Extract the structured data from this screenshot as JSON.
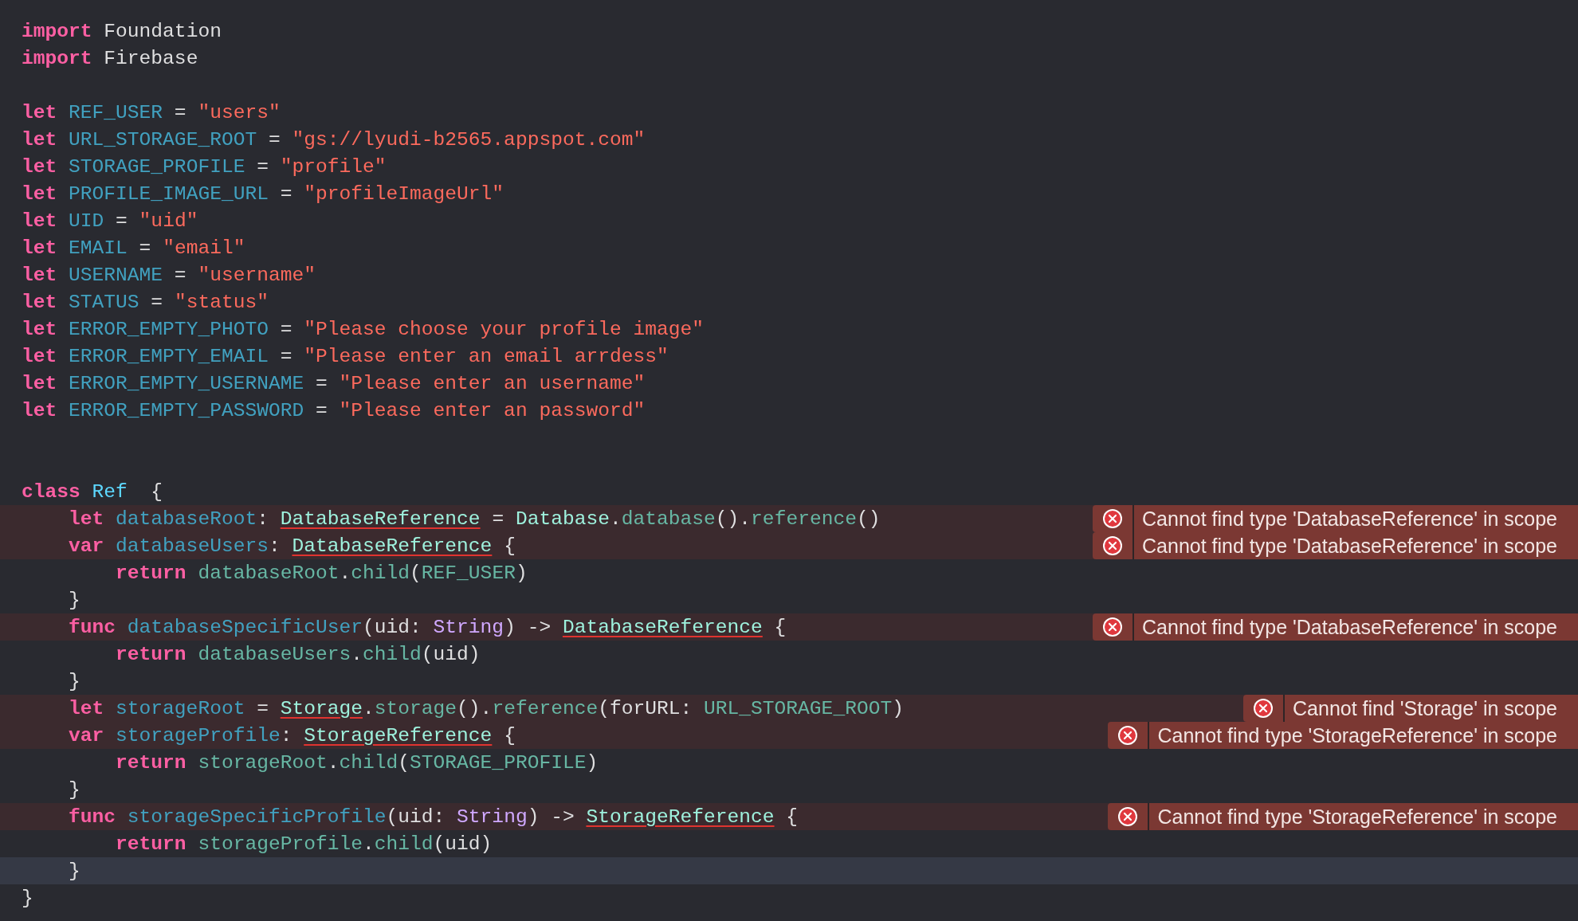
{
  "editor": {
    "lines": [
      {
        "current": false,
        "tokens": [
          {
            "kind": "keyword",
            "text": "import"
          },
          {
            "kind": "plain",
            "text": " Foundation"
          }
        ]
      },
      {
        "current": false,
        "tokens": [
          {
            "kind": "keyword",
            "text": "import"
          },
          {
            "kind": "plain",
            "text": " Firebase"
          }
        ]
      },
      {
        "current": false
      },
      {
        "current": false,
        "tokens": [
          {
            "kind": "keyword",
            "text": "let"
          },
          {
            "kind": "declaration",
            "text": " REF_USER"
          },
          {
            "kind": "plain",
            "text": " = "
          },
          {
            "kind": "string",
            "text": "\"users\""
          }
        ]
      },
      {
        "current": false,
        "tokens": [
          {
            "kind": "keyword",
            "text": "let"
          },
          {
            "kind": "declaration",
            "text": " URL_STORAGE_ROOT"
          },
          {
            "kind": "plain",
            "text": " = "
          },
          {
            "kind": "string",
            "text": "\"gs://lyudi-b2565.appspot.com\""
          }
        ]
      },
      {
        "current": false,
        "tokens": [
          {
            "kind": "keyword",
            "text": "let"
          },
          {
            "kind": "declaration",
            "text": " STORAGE_PROFILE"
          },
          {
            "kind": "plain",
            "text": " = "
          },
          {
            "kind": "string",
            "text": "\"profile\""
          }
        ]
      },
      {
        "current": false,
        "tokens": [
          {
            "kind": "keyword",
            "text": "let"
          },
          {
            "kind": "declaration",
            "text": " PROFILE_IMAGE_URL"
          },
          {
            "kind": "plain",
            "text": " = "
          },
          {
            "kind": "string",
            "text": "\"profileImageUrl\""
          }
        ]
      },
      {
        "current": false,
        "tokens": [
          {
            "kind": "keyword",
            "text": "let"
          },
          {
            "kind": "declaration",
            "text": " UID"
          },
          {
            "kind": "plain",
            "text": " = "
          },
          {
            "kind": "string",
            "text": "\"uid\""
          }
        ]
      },
      {
        "current": false,
        "tokens": [
          {
            "kind": "keyword",
            "text": "let"
          },
          {
            "kind": "declaration",
            "text": " EMAIL"
          },
          {
            "kind": "plain",
            "text": " = "
          },
          {
            "kind": "string",
            "text": "\"email\""
          }
        ]
      },
      {
        "current": false,
        "tokens": [
          {
            "kind": "keyword",
            "text": "let"
          },
          {
            "kind": "declaration",
            "text": " USERNAME"
          },
          {
            "kind": "plain",
            "text": " = "
          },
          {
            "kind": "string",
            "text": "\"username\""
          }
        ]
      },
      {
        "current": false,
        "tokens": [
          {
            "kind": "keyword",
            "text": "let"
          },
          {
            "kind": "declaration",
            "text": " STATUS"
          },
          {
            "kind": "plain",
            "text": " = "
          },
          {
            "kind": "string",
            "text": "\"status\""
          }
        ]
      },
      {
        "current": false,
        "tokens": [
          {
            "kind": "keyword",
            "text": "let"
          },
          {
            "kind": "declaration",
            "text": " ERROR_EMPTY_PHOTO"
          },
          {
            "kind": "plain",
            "text": " = "
          },
          {
            "kind": "string",
            "text": "\"Please choose your profile image\""
          }
        ]
      },
      {
        "current": false,
        "tokens": [
          {
            "kind": "keyword",
            "text": "let"
          },
          {
            "kind": "declaration",
            "text": " ERROR_EMPTY_EMAIL"
          },
          {
            "kind": "plain",
            "text": " = "
          },
          {
            "kind": "string",
            "text": "\"Please enter an email arrdess\""
          }
        ]
      },
      {
        "current": false,
        "tokens": [
          {
            "kind": "keyword",
            "text": "let"
          },
          {
            "kind": "declaration",
            "text": " ERROR_EMPTY_USERNAME"
          },
          {
            "kind": "plain",
            "text": " = "
          },
          {
            "kind": "string",
            "text": "\"Please enter an username\""
          }
        ]
      },
      {
        "current": false,
        "tokens": [
          {
            "kind": "keyword",
            "text": "let"
          },
          {
            "kind": "declaration",
            "text": " ERROR_EMPTY_PASSWORD"
          },
          {
            "kind": "plain",
            "text": " = "
          },
          {
            "kind": "string",
            "text": "\"Please enter an password\""
          }
        ]
      },
      {
        "current": false
      },
      {
        "current": false
      },
      {
        "current": false,
        "tokens": [
          {
            "kind": "keyword",
            "text": "class"
          },
          {
            "kind": "class_name",
            "text": " Ref"
          },
          {
            "kind": "plain",
            "text": "  {"
          }
        ]
      },
      {
        "current": false,
        "error": "Cannot find type 'DatabaseReference' in scope",
        "tokens": [
          {
            "kind": "keyword",
            "text": "    let"
          },
          {
            "kind": "declaration",
            "text": " databaseRoot"
          },
          {
            "kind": "plain",
            "text": ": "
          },
          {
            "kind": "unresolved",
            "text": "DatabaseReference"
          },
          {
            "kind": "plain",
            "text": " = "
          },
          {
            "kind": "project_type",
            "text": "Database"
          },
          {
            "kind": "plain",
            "text": "."
          },
          {
            "kind": "project",
            "text": "database"
          },
          {
            "kind": "plain",
            "text": "()."
          },
          {
            "kind": "project",
            "text": "reference"
          },
          {
            "kind": "plain",
            "text": "()"
          }
        ]
      },
      {
        "current": false,
        "error": "Cannot find type 'DatabaseReference' in scope",
        "tokens": [
          {
            "kind": "keyword",
            "text": "    var"
          },
          {
            "kind": "declaration",
            "text": " databaseUsers"
          },
          {
            "kind": "plain",
            "text": ": "
          },
          {
            "kind": "unresolved",
            "text": "DatabaseReference"
          },
          {
            "kind": "plain",
            "text": " {"
          }
        ]
      },
      {
        "current": false,
        "tokens": [
          {
            "kind": "keyword",
            "text": "        return"
          },
          {
            "kind": "project",
            "text": " databaseRoot"
          },
          {
            "kind": "plain",
            "text": "."
          },
          {
            "kind": "project",
            "text": "child"
          },
          {
            "kind": "plain",
            "text": "("
          },
          {
            "kind": "project",
            "text": "REF_USER"
          },
          {
            "kind": "plain",
            "text": ")"
          }
        ]
      },
      {
        "current": false,
        "tokens": [
          {
            "kind": "plain",
            "text": "    }"
          }
        ]
      },
      {
        "current": false,
        "error": "Cannot find type 'DatabaseReference' in scope",
        "tokens": [
          {
            "kind": "keyword",
            "text": "    func"
          },
          {
            "kind": "declaration",
            "text": " databaseSpecificUser"
          },
          {
            "kind": "plain",
            "text": "(uid: "
          },
          {
            "kind": "type",
            "text": "String"
          },
          {
            "kind": "plain",
            "text": ") -> "
          },
          {
            "kind": "unresolved",
            "text": "DatabaseReference"
          },
          {
            "kind": "plain",
            "text": " {"
          }
        ]
      },
      {
        "current": false,
        "tokens": [
          {
            "kind": "keyword",
            "text": "        return"
          },
          {
            "kind": "project",
            "text": " databaseUsers"
          },
          {
            "kind": "plain",
            "text": "."
          },
          {
            "kind": "project",
            "text": "child"
          },
          {
            "kind": "plain",
            "text": "(uid)"
          }
        ]
      },
      {
        "current": false,
        "tokens": [
          {
            "kind": "plain",
            "text": "    }"
          }
        ]
      },
      {
        "current": false,
        "error": "Cannot find 'Storage' in scope",
        "tokens": [
          {
            "kind": "keyword",
            "text": "    let"
          },
          {
            "kind": "declaration",
            "text": " storageRoot"
          },
          {
            "kind": "plain",
            "text": " = "
          },
          {
            "kind": "unresolved",
            "text": "Storage"
          },
          {
            "kind": "plain",
            "text": "."
          },
          {
            "kind": "project",
            "text": "storage"
          },
          {
            "kind": "plain",
            "text": "()."
          },
          {
            "kind": "project",
            "text": "reference"
          },
          {
            "kind": "plain",
            "text": "(forURL: "
          },
          {
            "kind": "project",
            "text": "URL_STORAGE_ROOT"
          },
          {
            "kind": "plain",
            "text": ")"
          }
        ]
      },
      {
        "current": false,
        "error": "Cannot find type 'StorageReference' in scope",
        "tokens": [
          {
            "kind": "keyword",
            "text": "    var"
          },
          {
            "kind": "declaration",
            "text": " storageProfile"
          },
          {
            "kind": "plain",
            "text": ": "
          },
          {
            "kind": "unresolved",
            "text": "StorageReference"
          },
          {
            "kind": "plain",
            "text": " {"
          }
        ]
      },
      {
        "current": false,
        "tokens": [
          {
            "kind": "keyword",
            "text": "        return"
          },
          {
            "kind": "project",
            "text": " storageRoot"
          },
          {
            "kind": "plain",
            "text": "."
          },
          {
            "kind": "project",
            "text": "child"
          },
          {
            "kind": "plain",
            "text": "("
          },
          {
            "kind": "project",
            "text": "STORAGE_PROFILE"
          },
          {
            "kind": "plain",
            "text": ")"
          }
        ]
      },
      {
        "current": false,
        "tokens": [
          {
            "kind": "plain",
            "text": "    }"
          }
        ]
      },
      {
        "current": false,
        "error": "Cannot find type 'StorageReference' in scope",
        "tokens": [
          {
            "kind": "keyword",
            "text": "    func"
          },
          {
            "kind": "declaration",
            "text": " storageSpecificProfile"
          },
          {
            "kind": "plain",
            "text": "(uid: "
          },
          {
            "kind": "type",
            "text": "String"
          },
          {
            "kind": "plain",
            "text": ") -> "
          },
          {
            "kind": "unresolved",
            "text": "StorageReference"
          },
          {
            "kind": "plain",
            "text": " {"
          }
        ]
      },
      {
        "current": false,
        "tokens": [
          {
            "kind": "keyword",
            "text": "        return"
          },
          {
            "kind": "project",
            "text": " storageProfile"
          },
          {
            "kind": "plain",
            "text": "."
          },
          {
            "kind": "project",
            "text": "child"
          },
          {
            "kind": "plain",
            "text": "(uid)"
          }
        ]
      },
      {
        "current": true,
        "tokens": [
          {
            "kind": "plain",
            "text": "    }"
          }
        ]
      },
      {
        "current": false,
        "tokens": [
          {
            "kind": "plain",
            "text": "}"
          }
        ]
      }
    ]
  }
}
